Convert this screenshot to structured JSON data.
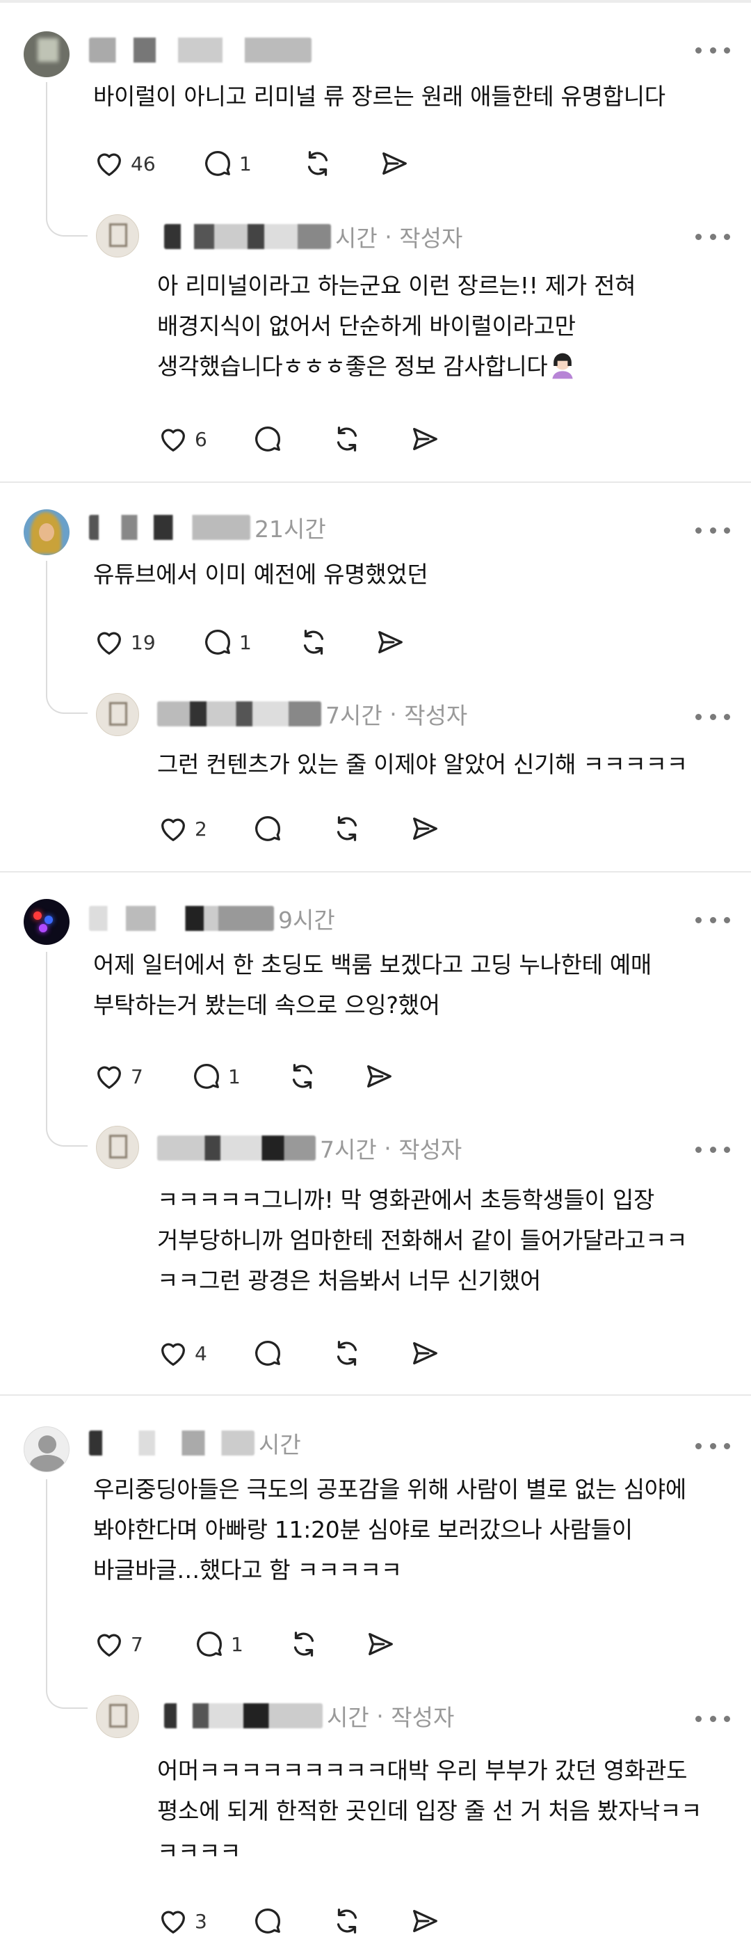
{
  "colors": {
    "meta_gray": "#999999",
    "text": "#111111",
    "icon": "#222222",
    "divider": "#e8e8e8"
  },
  "icons": [
    "heart-icon",
    "comment-icon",
    "repost-icon",
    "send-icon",
    "more-dots-icon"
  ],
  "comments": [
    {
      "time": "",
      "text": "바이럴이 아니고 리미널 류 장르는 원래 애들한테 유명합니다",
      "likes": "46",
      "replies": "1",
      "reply": {
        "time": "시간",
        "author_tag": "작성자",
        "text": "아 리미널이라고 하는군요 이런 장르는!! 제가 전혀\n배경지식이 없어서 단순하게 바이럴이라고만\n생각했습니다ㅎㅎㅎ좋은 정보 감사합니다",
        "likes": "6"
      }
    },
    {
      "time": "21시간",
      "text": "유튜브에서 이미 예전에 유명했었던",
      "likes": "19",
      "replies": "1",
      "reply": {
        "time": "7시간",
        "author_tag": "작성자",
        "text": "그런 컨텐츠가 있는 줄 이제야 알았어 신기해 ㅋㅋㅋㅋㅋ",
        "likes": "2"
      }
    },
    {
      "time": "9시간",
      "text": "어제 일터에서 한 초딩도 백룸 보겠다고 고딩 누나한테 예매\n부탁하는거 봤는데 속으로 으잉?했어",
      "likes": "7",
      "replies": "1",
      "reply": {
        "time": "7시간",
        "author_tag": "작성자",
        "text": "ㅋㅋㅋㅋㅋ그니까! 막 영화관에서 초등학생들이 입장\n거부당하니까 엄마한테 전화해서 같이 들어가달라고ㅋㅋ\nㅋㅋ그런 광경은 처음봐서 너무 신기했어",
        "likes": "4"
      }
    },
    {
      "time": "시간",
      "text": "우리중딩아들은 극도의 공포감을 위해 사람이 별로 없는 심야에\n봐야한다며 아빠랑 11:20분 심야로 보러갔으나 사람들이\n바글바글…했다고 함 ㅋㅋㅋㅋㅋ",
      "likes": "7",
      "replies": "1",
      "reply": {
        "time": "시간",
        "author_tag": "작성자",
        "text": "어머ㅋㅋㅋㅋㅋㅋㅋㅋㅋ대박 우리 부부가 갔던 영화관도\n평소에 되게 한적한 곳인데 입장 줄 선 거 처음 봤자낙ㅋㅋ\nㅋㅋㅋㅋ",
        "likes": "3"
      }
    }
  ]
}
